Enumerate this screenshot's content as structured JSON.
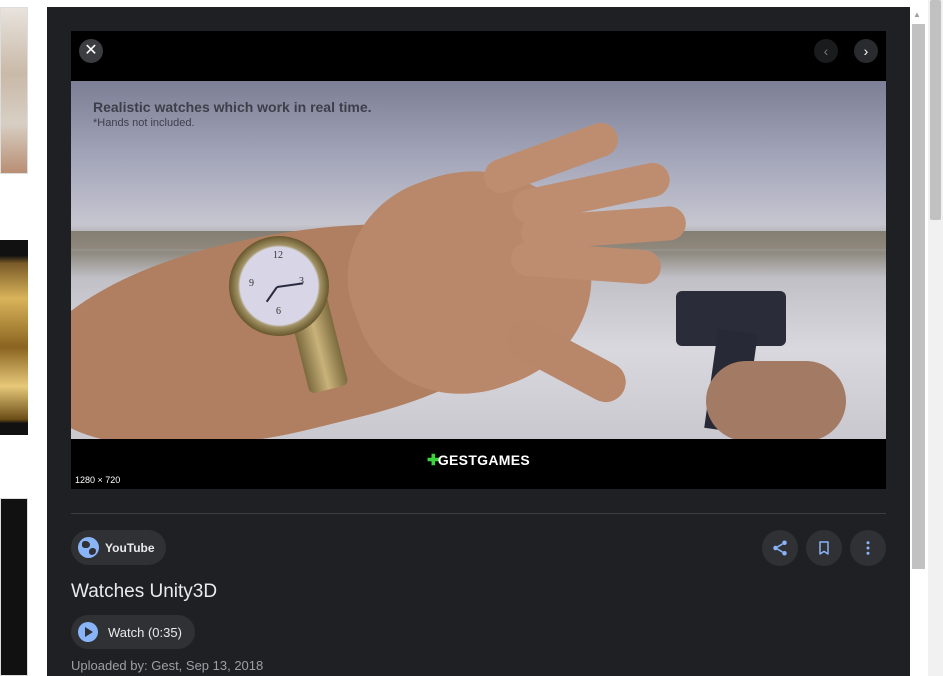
{
  "viewer": {
    "close_icon": "close-icon",
    "prev_icon": "chevron-left-icon",
    "next_icon": "chevron-right-icon",
    "image_caption_main": "Realistic watches which work in real time.",
    "image_caption_sub": "*Hands not included.",
    "logo_text": "GESTGAMES",
    "image_dimensions": "1280 × 720"
  },
  "source": {
    "icon": "globe-icon",
    "label": "YouTube"
  },
  "actions": [
    {
      "name": "share",
      "icon": "share-icon"
    },
    {
      "name": "save",
      "icon": "bookmark-icon"
    },
    {
      "name": "more",
      "icon": "more-vert-icon"
    }
  ],
  "title": "Watches Unity3D",
  "watch_button": {
    "icon": "play-icon",
    "label": "Watch (0:35)"
  },
  "uploaded_by": "Uploaded by: Gest, Sep 13, 2018",
  "colors": {
    "panel_bg": "#1f2023",
    "chip_bg": "#303134",
    "accent": "#8ab4f8",
    "text_primary": "#e8eaed",
    "text_secondary": "#9aa0a6"
  }
}
